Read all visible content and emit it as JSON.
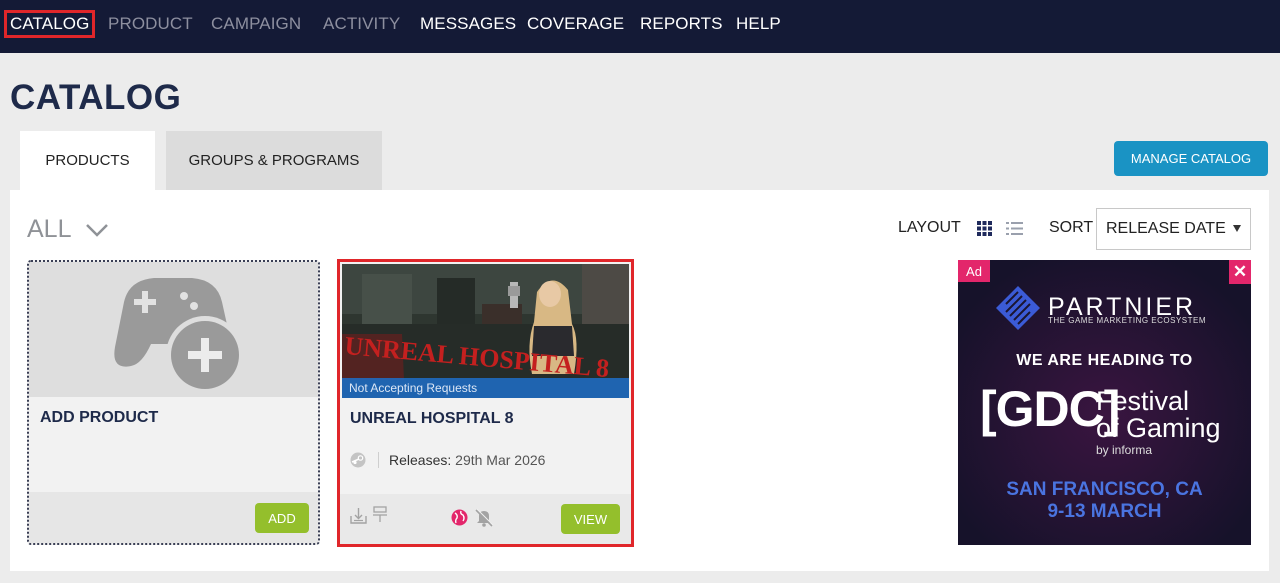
{
  "nav": {
    "items": [
      {
        "label": "CATALOG",
        "state": "active"
      },
      {
        "label": "PRODUCT",
        "state": "disabled"
      },
      {
        "label": "CAMPAIGN",
        "state": "disabled"
      },
      {
        "label": "ACTIVITY",
        "state": "disabled"
      },
      {
        "label": "MESSAGES",
        "state": "enabled"
      },
      {
        "label": "COVERAGE",
        "state": "enabled"
      },
      {
        "label": "REPORTS",
        "state": "enabled"
      },
      {
        "label": "HELP",
        "state": "enabled"
      }
    ]
  },
  "page": {
    "title": "CATALOG"
  },
  "tabs": [
    {
      "label": "PRODUCTS",
      "selected": true
    },
    {
      "label": "GROUPS & PROGRAMS",
      "selected": false
    }
  ],
  "actions": {
    "manage_catalog": "MANAGE CATALOG"
  },
  "filter": {
    "value": "ALL"
  },
  "toolbar": {
    "layout_label": "LAYOUT",
    "layout_mode": "grid",
    "sort_label": "SORT",
    "sort_value": "RELEASE DATE"
  },
  "cards": {
    "add": {
      "title": "ADD PRODUCT",
      "button": "ADD",
      "icon": "gamepad-add-icon"
    },
    "game": {
      "title": "UNREAL HOSPITAL 8",
      "status": "Not Accepting Requests",
      "cover_text": "UNREAL HOSPITAL 8",
      "platform_icon": "steam-icon",
      "release_label": "Releases:",
      "release_date": "29th Mar 2026",
      "button": "VIEW"
    }
  },
  "ad": {
    "label": "Ad",
    "close": "✕",
    "brand": "PARTNIER",
    "tagline": "THE GAME MARKETING ECOSYSTEM",
    "headline": "WE ARE HEADING TO",
    "event_logo": "[GDC]",
    "event_name_1": "Festival",
    "event_name_2": "of Gaming",
    "by": "by informa",
    "city": "SAN FRANCISCO, CA",
    "dates": "9-13 MARCH"
  },
  "colors": {
    "nav_bg": "#141a36",
    "accent_blue": "#1a93c4",
    "accent_green": "#94bf2c",
    "highlight_red": "#e0262a",
    "ad_pink": "#e3266b"
  }
}
